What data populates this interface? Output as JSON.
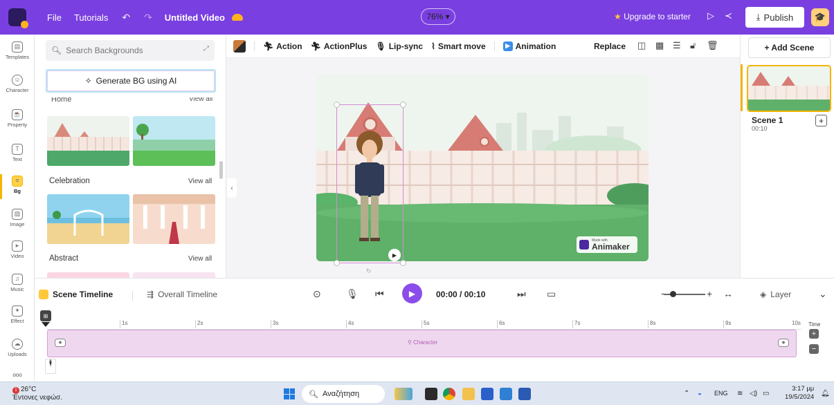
{
  "topbar": {
    "file": "File",
    "tutorials": "Tutorials",
    "project_title": "Untitled Video",
    "zoom": "76%",
    "upgrade": "Upgrade to starter",
    "publish": "Publish"
  },
  "rail": {
    "items": [
      {
        "label": "Templates",
        "icon": "templates-icon"
      },
      {
        "label": "Character",
        "icon": "character-icon"
      },
      {
        "label": "Property",
        "icon": "property-icon"
      },
      {
        "label": "Text",
        "icon": "text-icon"
      },
      {
        "label": "Bg",
        "icon": "bg-icon"
      },
      {
        "label": "Image",
        "icon": "image-icon"
      },
      {
        "label": "Video",
        "icon": "video-icon"
      },
      {
        "label": "Music",
        "icon": "music-icon"
      },
      {
        "label": "Effect",
        "icon": "effect-icon"
      },
      {
        "label": "Uploads",
        "icon": "uploads-icon"
      }
    ],
    "more": "ooo"
  },
  "panel": {
    "search_placeholder": "Search Backgrounds",
    "generate_bg": "Generate BG using AI",
    "cut_category": "Home",
    "view_all": "View all",
    "categories": [
      "Celebration",
      "Abstract"
    ]
  },
  "toolbar": {
    "action": "Action",
    "action_plus": "ActionPlus",
    "lip_sync": "Lip-sync",
    "smart_move": "Smart move",
    "animation": "Animation",
    "replace": "Replace"
  },
  "canvas": {
    "watermark_small": "Made with",
    "watermark_big": "Animaker"
  },
  "scenes": {
    "add_scene": "+ Add Scene",
    "scene_name": "Scene 1",
    "scene_time": "00:10"
  },
  "timeline": {
    "scene_timeline": "Scene Timeline",
    "overall_timeline": "Overall Timeline",
    "timecode": "00:00 / 00:10",
    "layer": "Layer",
    "ticks": [
      "1s",
      "2s",
      "3s",
      "4s",
      "5s",
      "6s",
      "7s",
      "8s",
      "9s",
      "10s"
    ],
    "time_label": "Time",
    "track_label": "Character"
  },
  "taskbar": {
    "temp": "26°C",
    "weather": "Έντονες νεφώσ.",
    "search": "Αναζήτηση",
    "lang": "ENG",
    "time": "3:17 μμ",
    "date": "19/5/2024",
    "notif_count": "1"
  },
  "colors": {
    "brand": "#7a3fe0",
    "accent": "#f4b400",
    "track": "#efd8ef"
  }
}
